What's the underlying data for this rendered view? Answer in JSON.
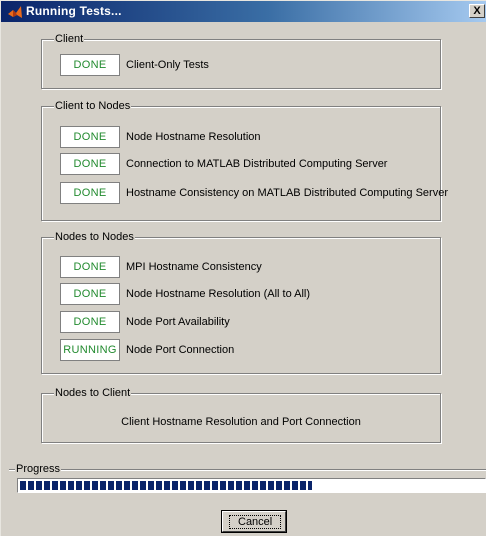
{
  "window": {
    "title": "Running Tests...",
    "close_glyph": "X"
  },
  "colors": {
    "status_text": "#218a2e",
    "progress_fill": "#0a246a",
    "title_bar": "#0a246a"
  },
  "groups": [
    {
      "title": "Client",
      "tests": [
        {
          "status": "DONE",
          "label": "Client-Only Tests"
        }
      ]
    },
    {
      "title": "Client to Nodes",
      "tests": [
        {
          "status": "DONE",
          "label": "Node Hostname Resolution"
        },
        {
          "status": "DONE",
          "label": "Connection to MATLAB Distributed Computing Server"
        },
        {
          "status": "DONE",
          "label": "Hostname Consistency on MATLAB Distributed Computing Server"
        }
      ]
    },
    {
      "title": "Nodes to Nodes",
      "tests": [
        {
          "status": "DONE",
          "label": "MPI Hostname Consistency"
        },
        {
          "status": "DONE",
          "label": "Node Hostname Resolution (All to All)"
        },
        {
          "status": "DONE",
          "label": "Node Port Availability"
        },
        {
          "status": "RUNNING",
          "label": "Node Port Connection"
        }
      ]
    },
    {
      "title": "Nodes to Client",
      "tests": [
        {
          "status": "",
          "label": "Client Hostname Resolution and Port Connection"
        }
      ]
    }
  ],
  "progress": {
    "label": "Progress",
    "fraction": 0.63
  },
  "cancel_button": {
    "label": "Cancel"
  }
}
